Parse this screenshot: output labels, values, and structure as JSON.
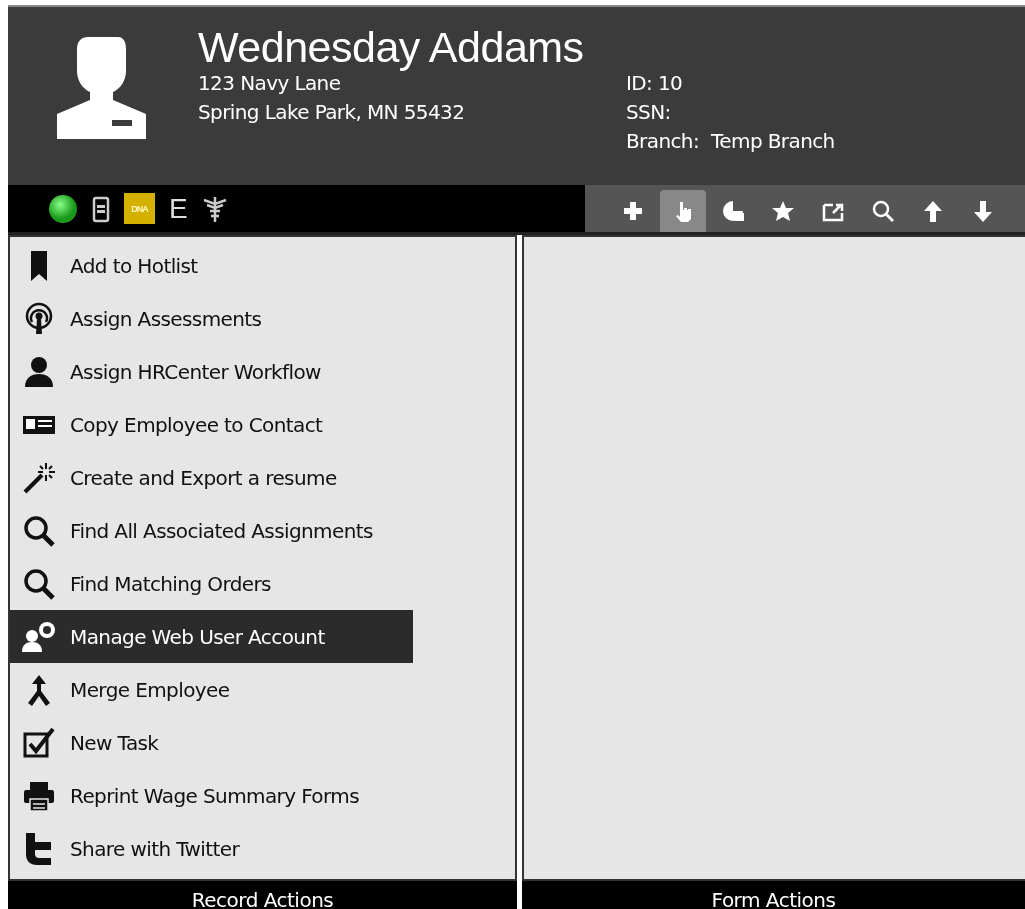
{
  "header": {
    "name": "Wednesday Addams",
    "address_line_1": "123 Navy Lane",
    "address_line_2": "Spring Lake Park, MN 55432",
    "id": "ID: 10",
    "ssn": "SSN:",
    "branch_label": "Branch:",
    "branch_value": "Temp Branch"
  },
  "status_icons": {
    "dna_badge": "DNA",
    "e_label": "E"
  },
  "toolbar": [
    {
      "selected": false
    },
    {
      "selected": true
    },
    {
      "selected": false
    },
    {
      "selected": false
    },
    {
      "selected": false
    },
    {
      "selected": false
    },
    {
      "selected": false
    },
    {
      "selected": false
    }
  ],
  "record_actions": [
    {
      "label": "Add to Hotlist",
      "selected": false
    },
    {
      "label": "Assign Assessments",
      "selected": false
    },
    {
      "label": "Assign HRCenter Workflow",
      "selected": false
    },
    {
      "label": "Copy Employee to Contact",
      "selected": false
    },
    {
      "label": "Create and Export a resume",
      "selected": false
    },
    {
      "label": "Find All Associated Assignments",
      "selected": false
    },
    {
      "label": "Find Matching Orders",
      "selected": false
    },
    {
      "label": "Manage Web User Account",
      "selected": true
    },
    {
      "label": "Merge Employee",
      "selected": false
    },
    {
      "label": "New Task",
      "selected": false
    },
    {
      "label": "Reprint Wage Summary Forms",
      "selected": false
    },
    {
      "label": "Share with Twitter",
      "selected": false
    }
  ],
  "footer": {
    "left_title": "Record Actions",
    "right_title": "Form Actions"
  }
}
